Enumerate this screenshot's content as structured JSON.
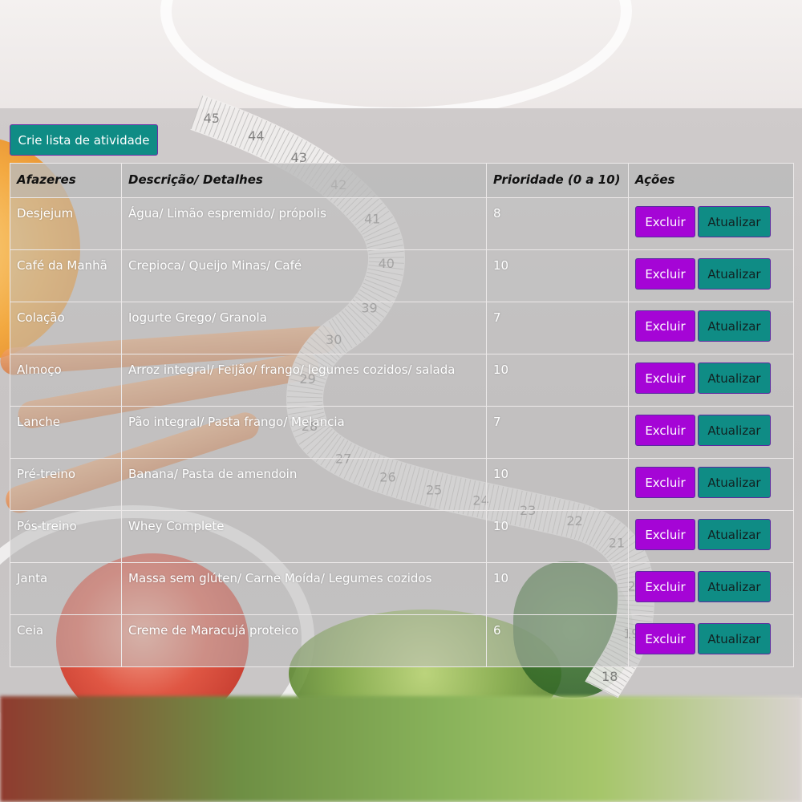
{
  "toolbar": {
    "create_label": "Crie lista de atividade"
  },
  "table": {
    "headers": [
      "Afazeres",
      "Descrição/ Detalhes",
      "Prioridade (0 a 10)",
      "Ações"
    ],
    "delete_label": "Excluir",
    "update_label": "Atualizar",
    "rows": [
      {
        "task": "Desjejum",
        "details": "Água/ Limão espremido/ própolis",
        "priority": "8"
      },
      {
        "task": "Café da Manhã",
        "details": "Crepioca/ Queijo Minas/ Café",
        "priority": "10"
      },
      {
        "task": "Colação",
        "details": "Iogurte Grego/ Granola",
        "priority": "7"
      },
      {
        "task": "Almoço",
        "details": "Arroz integral/ Feijão/ frango/ legumes cozidos/ salada",
        "priority": "10"
      },
      {
        "task": "Lanche",
        "details": "Pão integral/ Pasta frango/ Melancia",
        "priority": "7"
      },
      {
        "task": "Pré-treino",
        "details": "Banana/ Pasta de amendoin",
        "priority": "10"
      },
      {
        "task": "Pós-treino",
        "details": "Whey Complete",
        "priority": "10"
      },
      {
        "task": "Janta",
        "details": "Massa sem glúten/ Carne Moída/ Legumes cozidos",
        "priority": "10"
      },
      {
        "task": "Ceia",
        "details": "Creme de Maracujá proteico",
        "priority": "6"
      }
    ]
  },
  "colors": {
    "delete": "#a505d6",
    "update": "#0f8c85",
    "create": "#0f8c85"
  },
  "tape_numbers": [
    "45",
    "44",
    "43",
    "42",
    "41",
    "40",
    "39",
    "30",
    "29",
    "28",
    "27",
    "26",
    "25",
    "24",
    "23",
    "22",
    "21",
    "20",
    "19",
    "18"
  ]
}
